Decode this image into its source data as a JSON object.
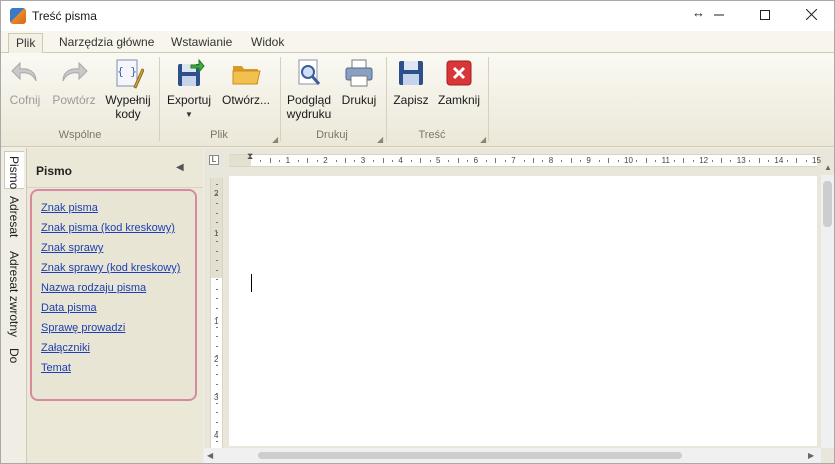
{
  "window": {
    "title": "Treść pisma"
  },
  "tabs": [
    "Plik",
    "Narzędzia główne",
    "Wstawianie",
    "Widok"
  ],
  "ribbon": {
    "groups": {
      "common": {
        "label": "Wspólne",
        "buttons": {
          "undo": "Cofnij",
          "redo": "Powtórz",
          "fill_codes": "Wypełnij kody"
        }
      },
      "file": {
        "label": "Plik",
        "buttons": {
          "export": "Exportuj",
          "open": "Otwórz..."
        }
      },
      "print": {
        "label": "Drukuj",
        "buttons": {
          "preview": "Podgląd wydruku",
          "print": "Drukuj"
        }
      },
      "content": {
        "label": "Treść",
        "buttons": {
          "save": "Zapisz",
          "close": "Zamknij"
        }
      }
    }
  },
  "side_tabs": [
    "Pismo",
    "Adresat",
    "Adresat zwrotny",
    "Do wiadomości"
  ],
  "panel": {
    "title": "Pismo",
    "fields": [
      "Znak pisma",
      "Znak pisma (kod kreskowy)",
      "Znak sprawy",
      "Znak sprawy (kod kreskowy)",
      "Nazwa rodzaju pisma",
      "Data pisma",
      "Sprawę prowadzi",
      "Załączniki",
      "Temat"
    ]
  },
  "ruler": {
    "corner": "L",
    "h_numbers": [
      "1",
      "2",
      "3",
      "4",
      "5",
      "6",
      "7",
      "8",
      "9",
      "10",
      "11",
      "12",
      "13",
      "14",
      "15"
    ],
    "v_numbers": [
      "2",
      "1",
      "1",
      "2",
      "3",
      "4"
    ]
  },
  "icons": {
    "undo": "undo-arrow-icon",
    "redo": "redo-arrow-icon",
    "fill_codes": "code-pencil-icon",
    "export": "export-disk-icon",
    "open": "folder-icon",
    "preview": "magnifier-page-icon",
    "print": "printer-icon",
    "save": "floppy-icon",
    "close": "red-x-icon"
  },
  "colors": {
    "accent_link": "#1c3fb3",
    "highlight_border": "#d58aa0",
    "close_red": "#d9363a"
  }
}
